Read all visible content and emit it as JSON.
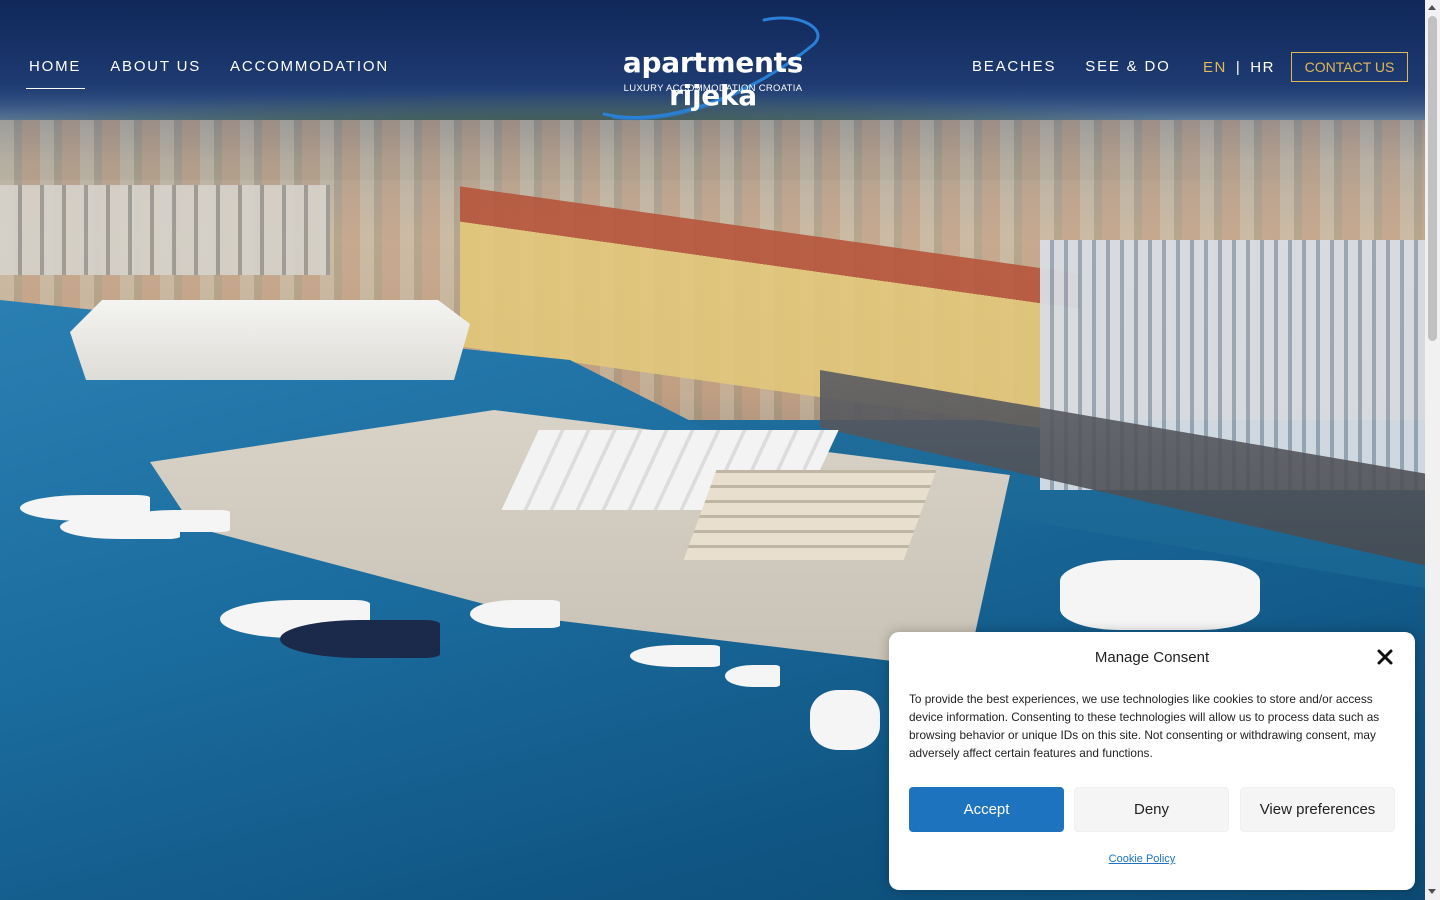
{
  "nav": {
    "left": [
      {
        "label": "HOME",
        "active": true
      },
      {
        "label": "ABOUT US"
      },
      {
        "label": "ACCOMMODATION"
      }
    ],
    "right": [
      {
        "label": "BEACHES"
      },
      {
        "label": "SEE & DO"
      }
    ],
    "lang_en": "EN",
    "lang_sep": "|",
    "lang_hr": "HR",
    "contact": "CONTACT US"
  },
  "logo": {
    "brand": "apartments rijeka",
    "tagline": "LUXURY ACCOMMODATION CROATIA"
  },
  "consent": {
    "title": "Manage Consent",
    "text": "To provide the best experiences, we use technologies like cookies to store and/or access device information. Consenting to these technologies will allow us to process data such as browsing behavior or unique IDs on this site. Not consenting or withdrawing consent, may adversely affect certain features and functions.",
    "accept": "Accept",
    "deny": "Deny",
    "preferences": "View preferences",
    "policy_link": "Cookie Policy"
  },
  "colors": {
    "accent_gold": "#e0b85a",
    "accept_blue": "#1e73be",
    "logo_swoosh": "#2a7fd6"
  }
}
